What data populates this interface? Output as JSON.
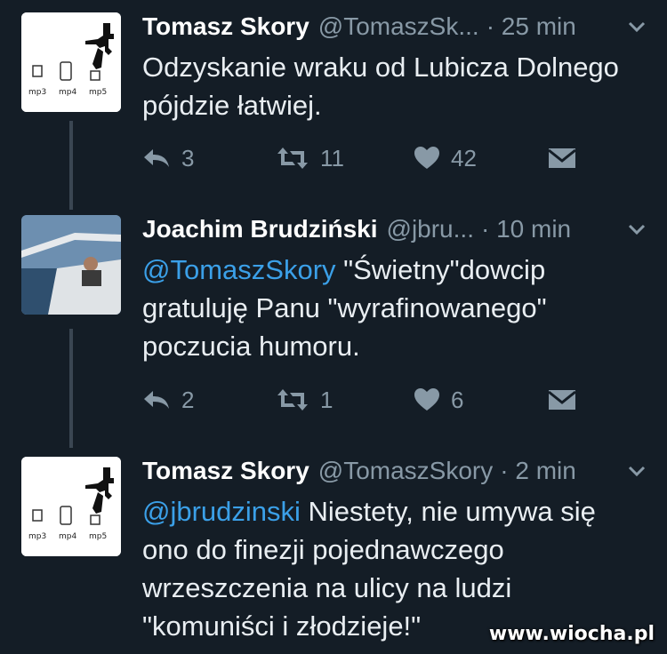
{
  "tweets": [
    {
      "name": "Tomasz Skory",
      "handle": "@TomaszSk...",
      "time": "· 25 min",
      "text": "Odzyskanie wraku od Lubicza Dolnego pójdzie łatwiej.",
      "mention": "",
      "replies": "3",
      "retweets": "11",
      "likes": "42"
    },
    {
      "name": "Joachim Brudziński",
      "handle": "@jbru...",
      "time": "· 10 min",
      "mention": "@TomaszSkory",
      "text": " \"Świetny\"dowcip gratuluję Panu \"wyrafinowanego\" poczucia humoru.",
      "replies": "2",
      "retweets": "1",
      "likes": "6"
    },
    {
      "name": "Tomasz Skory",
      "handle": "@TomaszSkory",
      "time": "· 2 min",
      "mention": "@jbrudzinski",
      "text": " Niestety, nie umywa się ono do finezji pojednawczego wrzeszczenia na ulicy na ludzi \"komuniści i złodzieje!\""
    }
  ],
  "avatar_labels": [
    "mp3",
    "mp4",
    "mp5"
  ],
  "watermark": "www.wiocha.pl"
}
